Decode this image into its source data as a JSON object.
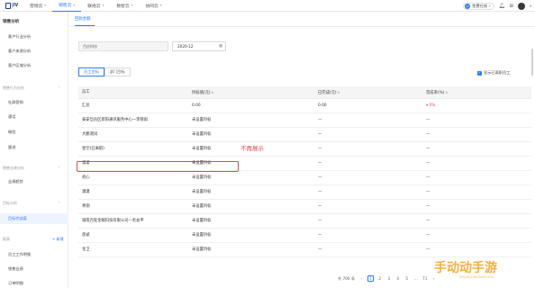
{
  "nav": {
    "items": [
      {
        "label": "营销云"
      },
      {
        "label": "销售云"
      },
      {
        "label": "联络云"
      },
      {
        "label": "数智云"
      },
      {
        "label": "协同云"
      }
    ],
    "active_index": 1,
    "status_pill": "免费在线",
    "accent": "#2d7cf6"
  },
  "sidebar": {
    "top_label": "销售分析",
    "items_a": [
      {
        "label": "客户行业分析"
      },
      {
        "label": "客户来源分析"
      },
      {
        "label": "客户区域分析"
      }
    ],
    "group_b": "销售行为分析",
    "items_b": [
      {
        "label": "社群营销"
      },
      {
        "label": "通话"
      },
      {
        "label": "微信"
      },
      {
        "label": "跟进"
      }
    ],
    "group_c": "销售业绩分析",
    "items_c": [
      {
        "label": "业绩趋势"
      }
    ],
    "group_d": "目标分析",
    "items_d": [
      {
        "label": "目标完成度"
      }
    ],
    "group_e": "报表",
    "add_label": "+ 新建",
    "items_e": [
      {
        "label": "员工工作明细"
      },
      {
        "label": "销售业绩"
      },
      {
        "label": "订单明细"
      }
    ]
  },
  "main": {
    "tab": "回款金额",
    "filter_value": "百应科技",
    "date_value": "2020-12",
    "segments": [
      "员工目标",
      "部门目标"
    ],
    "checkbox_label": "显示已离职员工",
    "columns": [
      "员工",
      "目标值(元)",
      "已完成(元)",
      "完成率(%)"
    ],
    "rows": [
      {
        "name": "汇总",
        "target": "0.00",
        "done": "0.00",
        "rate": "0%"
      },
      {
        "name": "泰安岱岳区新阳通讯服务中心一李晓雨",
        "target": "未设置目标",
        "done": "—",
        "rate": "—"
      },
      {
        "name": "大鹏测试",
        "target": "未设置目标",
        "done": "—",
        "rate": "—"
      },
      {
        "name": "星空(已离职)",
        "target": "未设置目标",
        "done": "—",
        "rate": "—"
      },
      {
        "name": "潇潇",
        "target": "未设置目标",
        "done": "—",
        "rate": "—"
      },
      {
        "name": "初心",
        "target": "未设置目标",
        "done": "—",
        "rate": "—"
      },
      {
        "name": "潇潇",
        "target": "未设置目标",
        "done": "—",
        "rate": "—"
      },
      {
        "name": "青铜",
        "target": "未设置目标",
        "done": "—",
        "rate": "—"
      },
      {
        "name": "湖南百旺金赋科技有限公司一毛益平",
        "target": "未设置目标",
        "done": "—",
        "rate": "—"
      },
      {
        "name": "彦斌",
        "target": "未设置目标",
        "done": "—",
        "rate": "—"
      },
      {
        "name": "金卫",
        "target": "未设置目标",
        "done": "—",
        "rate": "—"
      }
    ],
    "annotation": "不再展示",
    "pager": {
      "total": "共 706 条",
      "pages": [
        "1",
        "2",
        "3",
        "4",
        "5",
        "…",
        "71"
      ],
      "current_index": 0
    }
  },
  "watermark": {
    "text": "手动动手游",
    "sub": "SHOUDONGSHOUYOU"
  }
}
